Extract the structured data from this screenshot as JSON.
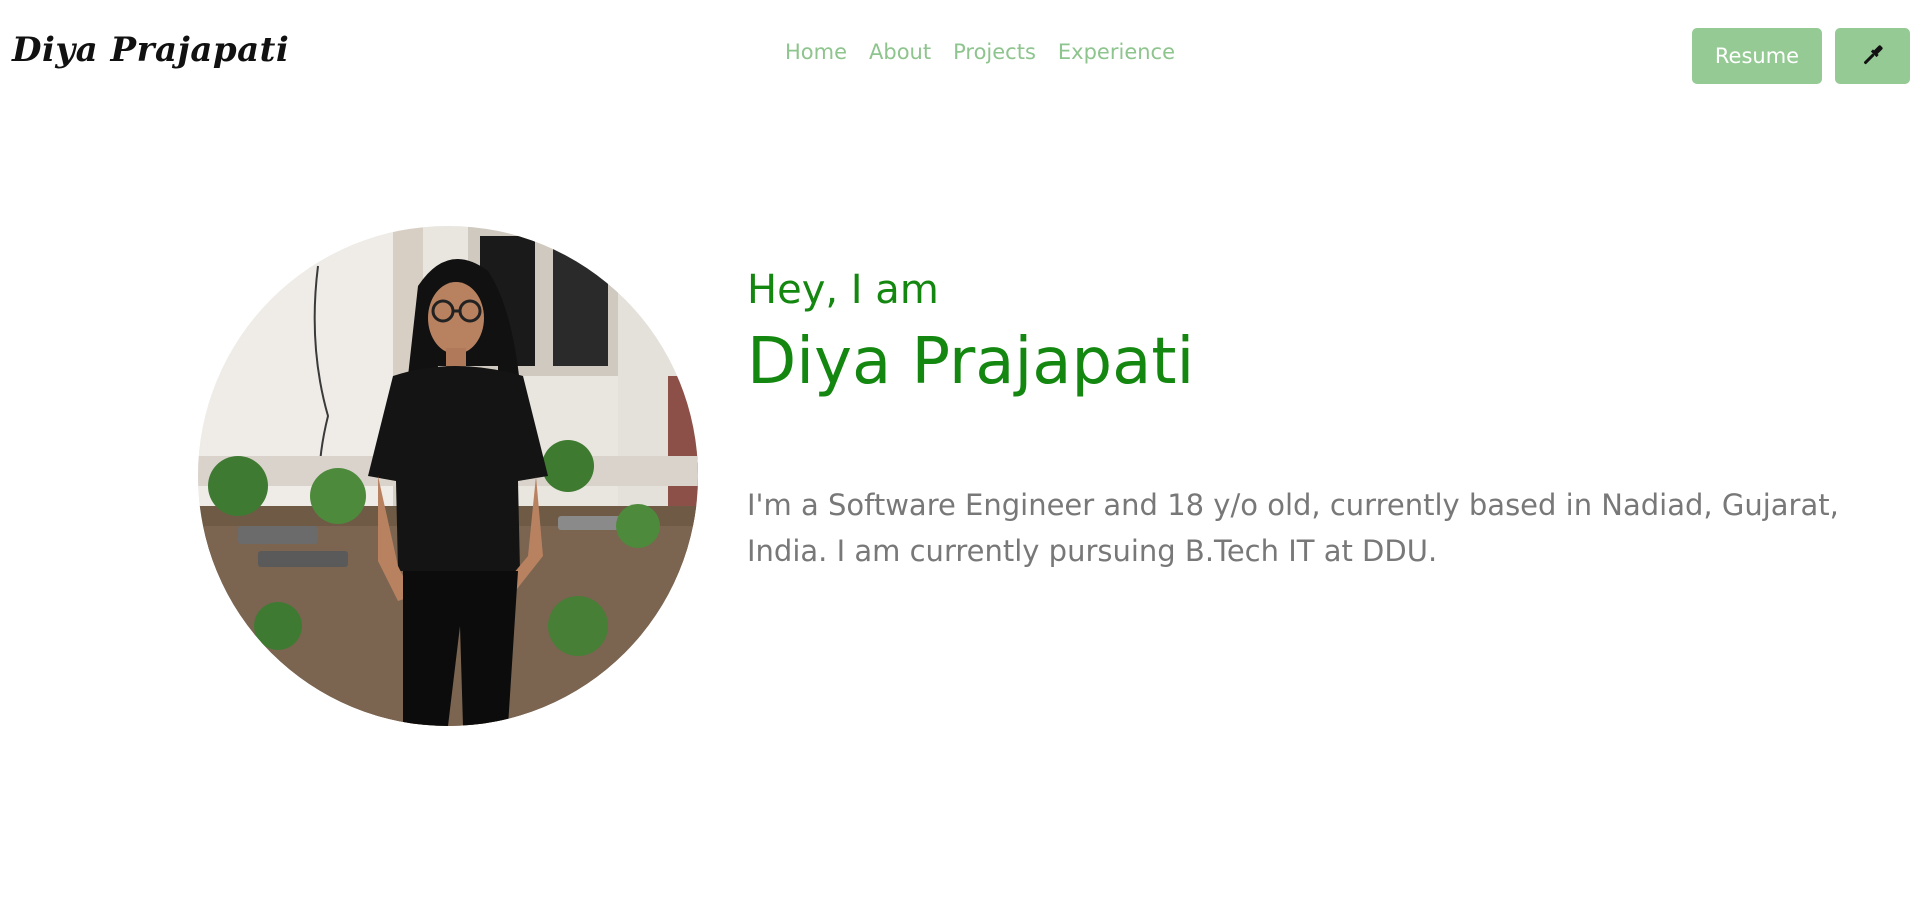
{
  "header": {
    "logo": "Diya Prajapati",
    "nav": [
      {
        "label": "Home"
      },
      {
        "label": "About"
      },
      {
        "label": "Projects"
      },
      {
        "label": "Experience"
      }
    ],
    "resume_label": "Resume",
    "theme_toggle_icon": "paint-brush-icon"
  },
  "hero": {
    "greeting": "Hey, I am",
    "name": "Diya Prajapati",
    "bio": "I'm a Software Engineer and 18 y/o old, currently based in Nadiad, Gujarat, India. I am currently pursuing B.Tech IT at DDU.",
    "photo_icon": "profile-photo"
  },
  "colors": {
    "accent_green": "#13870f",
    "nav_green": "#8ec48d",
    "button_green": "#95ca95",
    "bio_gray": "#787878"
  }
}
